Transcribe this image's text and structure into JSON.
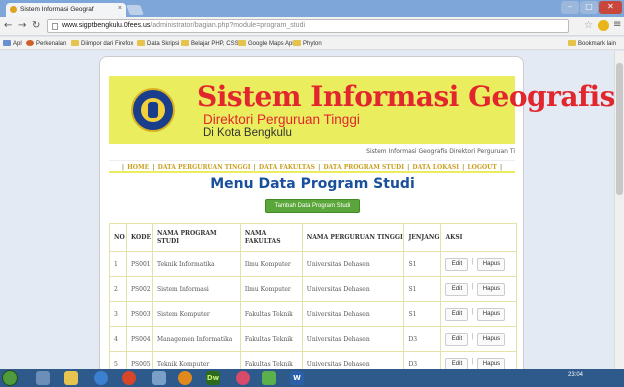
{
  "browser": {
    "tab_title": "Sistem Informasi Geograf",
    "tab_close": "×",
    "url_host": "www.sigptbengkulu.0fees.us",
    "url_path": "/administrator/bagian.php?module=program_studi",
    "bookmarks": [
      "Apl",
      "Perkenalan",
      "Diimpor dari Firefox",
      "Data Skripsi",
      "Belajar PHP, CSS",
      "Google Maps Api",
      "Phyton"
    ],
    "other_bookmarks": "Bookmark lain"
  },
  "header": {
    "title": "Sistem Informasi Geografis",
    "subtitle": "Direktori Perguruan Tinggi",
    "city": "Di Kota Bengkulu",
    "marquee": "Sistem Informasi Geografis Direktori Perguruan Ti"
  },
  "nav": {
    "items": [
      "HOME",
      "DATA PERGURUAN TINGGI",
      "DATA FAKULTAS",
      "DATA PROGRAM STUDI",
      "DATA LOKASI",
      "LOGOUT"
    ]
  },
  "page": {
    "heading": "Menu Data Program Studi",
    "add_button": "Tambah Data Program Studi"
  },
  "table": {
    "headers": [
      "NO",
      "KODE",
      "NAMA PROGRAM STUDI",
      "NAMA FAKULTAS",
      "NAMA PERGURUAN TINGGI",
      "JENJANG",
      "AKSI"
    ],
    "rows": [
      [
        "1",
        "PS001",
        "Teknik Informatika",
        "Ilmu Komputer",
        "Universitas Dehasen",
        "S1"
      ],
      [
        "2",
        "PS002",
        "Sistem Informasi",
        "Ilmu Komputer",
        "Universitas Dehasen",
        "S1"
      ],
      [
        "3",
        "PS003",
        "Sistem Komputer",
        "Fakultas Teknik",
        "Universitas Dehasen",
        "S1"
      ],
      [
        "4",
        "PS004",
        "Managemen Informatika",
        "Fakultas Teknik",
        "Universitas Dehasen",
        "D3"
      ],
      [
        "5",
        "PS005",
        "Teknik Komputer",
        "Fakultas Teknik",
        "Universitas Dehasen",
        "D3"
      ]
    ],
    "edit_label": "Edit",
    "hapus_label": "Hapus",
    "sep": "|"
  },
  "taskbar": {
    "clock_time": "23:04"
  },
  "icons": {
    "start": "windows-start-icon",
    "chrome": "chrome-icon",
    "dreamweaver": "Dw",
    "word": "W"
  },
  "colors": {
    "banner_bg": "#e9ed5e",
    "title_red": "#e2262e",
    "heading_blue": "#1a4f9c",
    "add_green": "#5aa63a",
    "menu_gold": "#c8a020"
  }
}
